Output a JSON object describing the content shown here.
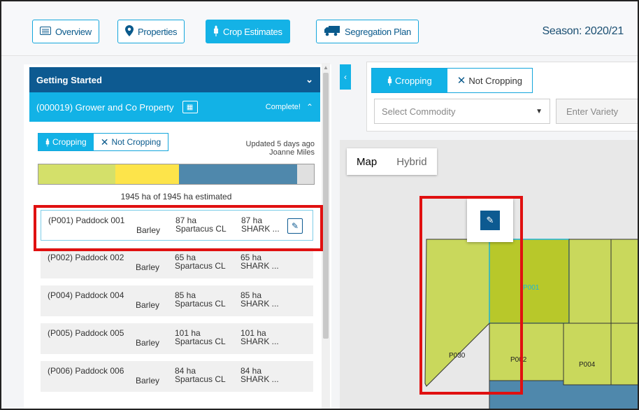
{
  "nav": {
    "overview": "Overview",
    "properties": "Properties",
    "crop_estimates": "Crop Estimates",
    "segregation_plan": "Segregation Plan",
    "season": "Season: 2020/21"
  },
  "left": {
    "getting_started": "Getting Started",
    "property": "(000019) Grower and Co Property",
    "complete": "Complete!",
    "cropping": "Cropping",
    "not_cropping": "Not Cropping",
    "updated": "Updated 5 days ago",
    "updated_by": "Joanne Miles",
    "estimate_text": "1945 ha of 1945 ha estimated",
    "progress": [
      {
        "color": "#d4e06a",
        "fraction": 0.28
      },
      {
        "color": "#fde44a",
        "fraction": 0.23
      },
      {
        "color": "#4f88ac",
        "fraction": 0.43
      },
      {
        "color": "#e0e0e0",
        "fraction": 0.06
      }
    ],
    "rows": [
      {
        "name": "(P001) Paddock 001",
        "crop": "Barley",
        "ha1": "87 ha",
        "variety": "Spartacus CL",
        "ha2": "87 ha",
        "seg": "SHARK ..."
      },
      {
        "name": "(P002) Paddock 002",
        "crop": "Barley",
        "ha1": "65 ha",
        "variety": "Spartacus CL",
        "ha2": "65 ha",
        "seg": "SHARK ..."
      },
      {
        "name": "(P004) Paddock 004",
        "crop": "Barley",
        "ha1": "85 ha",
        "variety": "Spartacus CL",
        "ha2": "85 ha",
        "seg": "SHARK ..."
      },
      {
        "name": "(P005) Paddock 005",
        "crop": "Barley",
        "ha1": "101 ha",
        "variety": "Spartacus CL",
        "ha2": "101 ha",
        "seg": "SHARK ..."
      },
      {
        "name": "(P006) Paddock 006",
        "crop": "Barley",
        "ha1": "84 ha",
        "variety": "Spartacus CL",
        "ha2": "84 ha",
        "seg": "SHARK ..."
      }
    ]
  },
  "right": {
    "cropping": "Cropping",
    "not_cropping": "Not Cropping",
    "select_commodity": "Select Commodity",
    "enter_variety": "Enter Variety",
    "map": "Map",
    "hybrid": "Hybrid",
    "paddocks": [
      "P001",
      "P030",
      "P002",
      "P004"
    ]
  },
  "colors": {
    "accent": "#12b2e6",
    "dark": "#0d5a91",
    "highlight": "#e01010"
  }
}
